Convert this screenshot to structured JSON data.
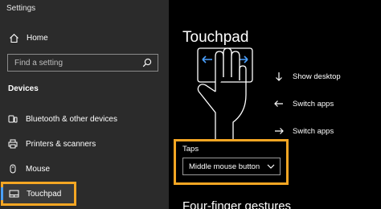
{
  "app": {
    "title": "Settings"
  },
  "sidebar": {
    "home_label": "Home",
    "search_placeholder": "Find a setting",
    "section_title": "Devices",
    "items": [
      {
        "label": "Bluetooth & other devices",
        "icon": "bluetooth-icon"
      },
      {
        "label": "Printers & scanners",
        "icon": "printer-icon"
      },
      {
        "label": "Mouse",
        "icon": "mouse-icon"
      },
      {
        "label": "Touchpad",
        "icon": "touchpad-icon",
        "selected": true
      }
    ]
  },
  "main": {
    "title": "Touchpad",
    "gestures": [
      {
        "label": "Show desktop",
        "icon": "arrow-down-icon"
      },
      {
        "label": "Switch apps",
        "icon": "arrow-left-icon"
      },
      {
        "label": "Switch apps",
        "icon": "arrow-right-icon"
      }
    ],
    "taps_label": "Taps",
    "taps_value": "Middle mouse button",
    "section_heading": "Four-finger gestures"
  },
  "colors": {
    "sidebar_bg": "#2b2b2b",
    "main_bg": "#000000",
    "highlight": "#f5a623",
    "accent": "#4aa0ff"
  }
}
